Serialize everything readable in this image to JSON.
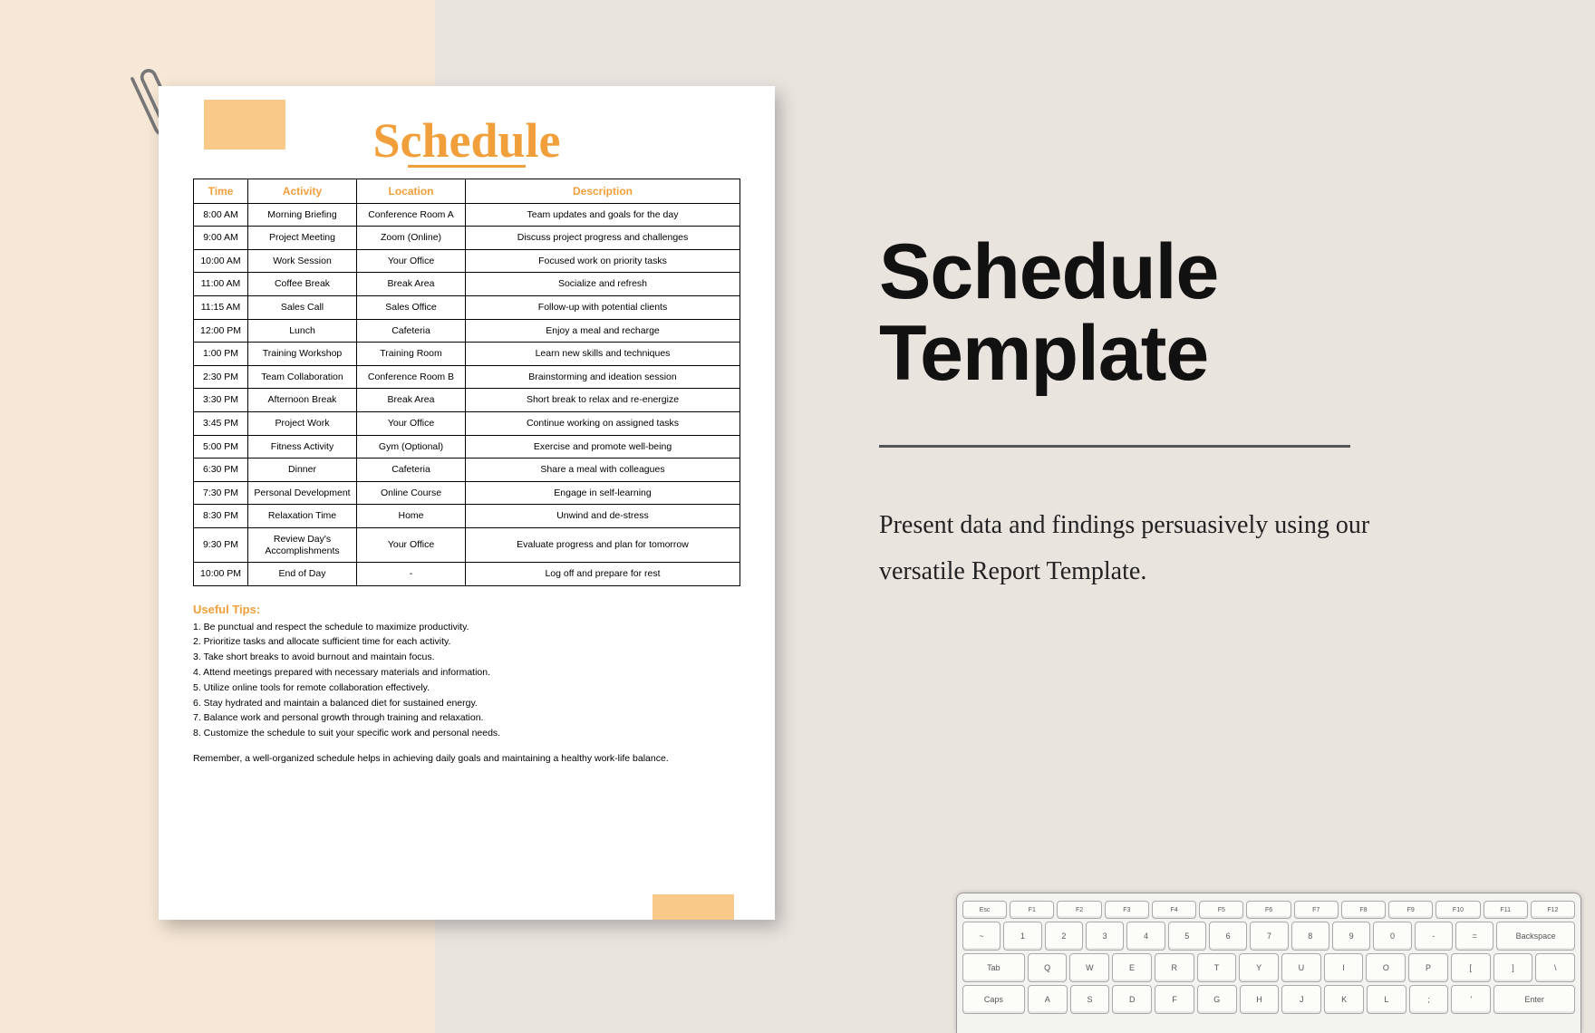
{
  "doc": {
    "title": "Schedule",
    "columns": [
      "Time",
      "Activity",
      "Location",
      "Description"
    ],
    "rows": [
      {
        "time": "8:00 AM",
        "activity": "Morning Briefing",
        "location": "Conference Room A",
        "desc": "Team updates and goals for the day"
      },
      {
        "time": "9:00 AM",
        "activity": "Project Meeting",
        "location": "Zoom (Online)",
        "desc": "Discuss project progress and challenges"
      },
      {
        "time": "10:00 AM",
        "activity": "Work Session",
        "location": "Your Office",
        "desc": "Focused work on priority tasks"
      },
      {
        "time": "11:00 AM",
        "activity": "Coffee Break",
        "location": "Break Area",
        "desc": "Socialize and refresh"
      },
      {
        "time": "11:15 AM",
        "activity": "Sales Call",
        "location": "Sales Office",
        "desc": "Follow-up with potential clients"
      },
      {
        "time": "12:00 PM",
        "activity": "Lunch",
        "location": "Cafeteria",
        "desc": "Enjoy a meal and recharge"
      },
      {
        "time": "1:00 PM",
        "activity": "Training Workshop",
        "location": "Training Room",
        "desc": "Learn new skills and techniques"
      },
      {
        "time": "2:30 PM",
        "activity": "Team Collaboration",
        "location": "Conference Room B",
        "desc": "Brainstorming and ideation session"
      },
      {
        "time": "3:30 PM",
        "activity": "Afternoon Break",
        "location": "Break Area",
        "desc": "Short break to relax and re-energize"
      },
      {
        "time": "3:45 PM",
        "activity": "Project Work",
        "location": "Your Office",
        "desc": "Continue working on assigned tasks"
      },
      {
        "time": "5:00 PM",
        "activity": "Fitness Activity",
        "location": "Gym (Optional)",
        "desc": "Exercise and promote well-being"
      },
      {
        "time": "6:30 PM",
        "activity": "Dinner",
        "location": "Cafeteria",
        "desc": "Share a meal with colleagues"
      },
      {
        "time": "7:30 PM",
        "activity": "Personal Development",
        "location": "Online Course",
        "desc": "Engage in self-learning"
      },
      {
        "time": "8:30 PM",
        "activity": "Relaxation Time",
        "location": "Home",
        "desc": "Unwind and de-stress"
      },
      {
        "time": "9:30 PM",
        "activity": "Review Day's Accomplishments",
        "location": "Your Office",
        "desc": "Evaluate progress and plan for tomorrow"
      },
      {
        "time": "10:00 PM",
        "activity": "End of Day",
        "location": "-",
        "desc": "Log off and prepare for rest"
      }
    ],
    "tips_heading": "Useful Tips:",
    "tips": [
      "1. Be punctual and respect the schedule to maximize productivity.",
      "2. Prioritize tasks and allocate sufficient time for each activity.",
      "3. Take short breaks to avoid burnout and maintain focus.",
      "4. Attend meetings prepared with necessary materials and information.",
      "5. Utilize online tools for remote collaboration effectively.",
      "6. Stay hydrated and maintain a balanced diet for sustained energy.",
      "7. Balance work and personal growth through training and relaxation.",
      "8. Customize the schedule to suit your specific work and personal needs."
    ],
    "closing": "Remember, a well-organized schedule helps in achieving daily goals and maintaining a healthy work-life balance."
  },
  "right": {
    "title_l1": "Schedule",
    "title_l2": "Template",
    "desc": "Present data and findings persuasively using our versatile Report Template."
  },
  "keyboard": {
    "row0": [
      "Esc",
      "F1",
      "F2",
      "F3",
      "F4",
      "F5",
      "F6",
      "F7",
      "F8",
      "F9",
      "F10",
      "F11",
      "F12"
    ],
    "row1": [
      "~",
      "1",
      "2",
      "3",
      "4",
      "5",
      "6",
      "7",
      "8",
      "9",
      "0",
      "-",
      "=",
      "Backspace"
    ],
    "row2": [
      "Tab",
      "Q",
      "W",
      "E",
      "R",
      "T",
      "Y",
      "U",
      "I",
      "O",
      "P",
      "[",
      "]",
      "\\"
    ],
    "row3": [
      "Caps",
      "A",
      "S",
      "D",
      "F",
      "G",
      "H",
      "J",
      "K",
      "L",
      ";",
      "'",
      "Enter"
    ]
  }
}
